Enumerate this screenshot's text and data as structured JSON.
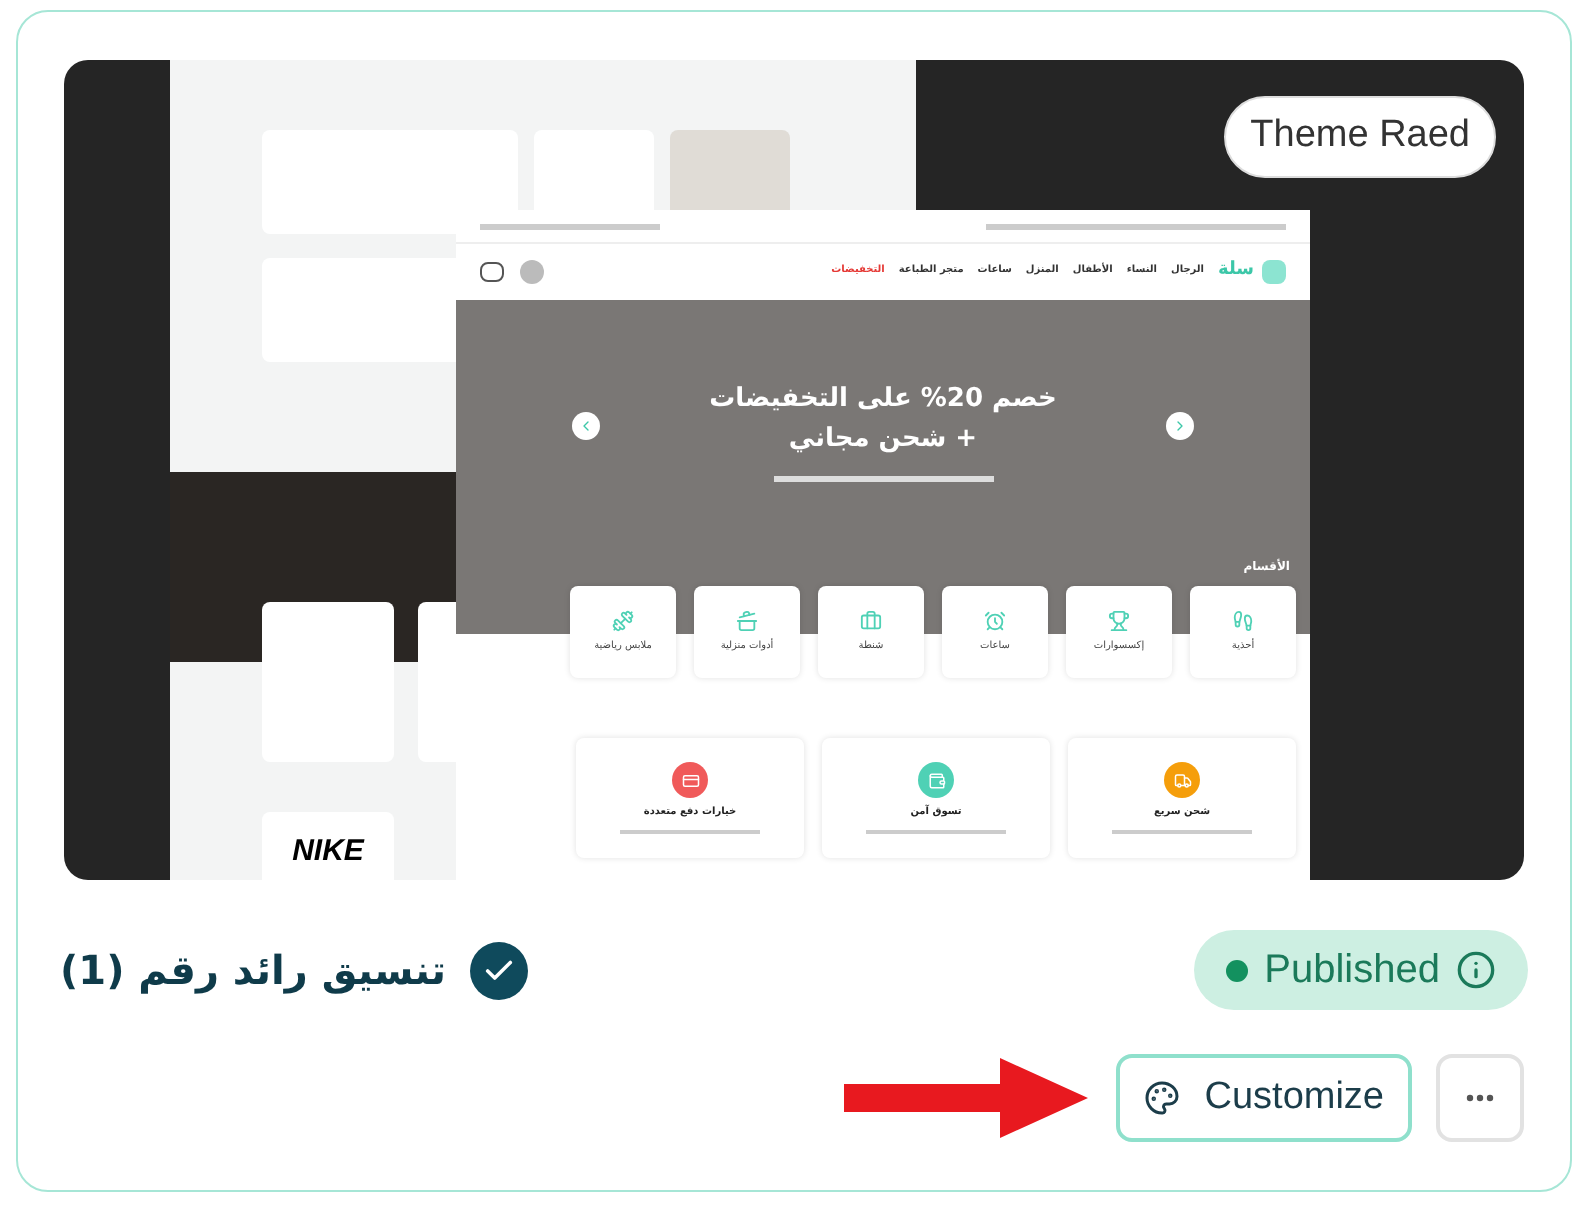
{
  "preview": {
    "badge": "Theme Raed",
    "store": {
      "logo": "سلة",
      "nav": [
        {
          "label": "الرجال",
          "highlight": false
        },
        {
          "label": "النساء",
          "highlight": false
        },
        {
          "label": "الأطفال",
          "highlight": false
        },
        {
          "label": "المنزل",
          "highlight": false
        },
        {
          "label": "ساعات",
          "highlight": false
        },
        {
          "label": "متجر الطباعة",
          "highlight": false
        },
        {
          "label": "التخفيضات",
          "highlight": true
        }
      ],
      "hero_title": "خصم 20% على التخفيضات + شحن مجاني",
      "categories_heading": "الأقسام",
      "categories": [
        "أحذية",
        "إكسسوارات",
        "ساعات",
        "شنطة",
        "أدوات منزلية",
        "ملابس رياضية"
      ],
      "features": [
        {
          "title": "شحن سريع",
          "color": "#f59e0b"
        },
        {
          "title": "تسوق آمن",
          "color": "#4fd1b5"
        },
        {
          "title": "خيارات دفع متعددة",
          "color": "#f05a5a"
        }
      ],
      "brand_logo": "NIKE"
    }
  },
  "theme": {
    "name": "تنسيق رائد رقم (1)",
    "active": true
  },
  "status": {
    "label": "Published",
    "published": true
  },
  "actions": {
    "customize": "Customize"
  }
}
